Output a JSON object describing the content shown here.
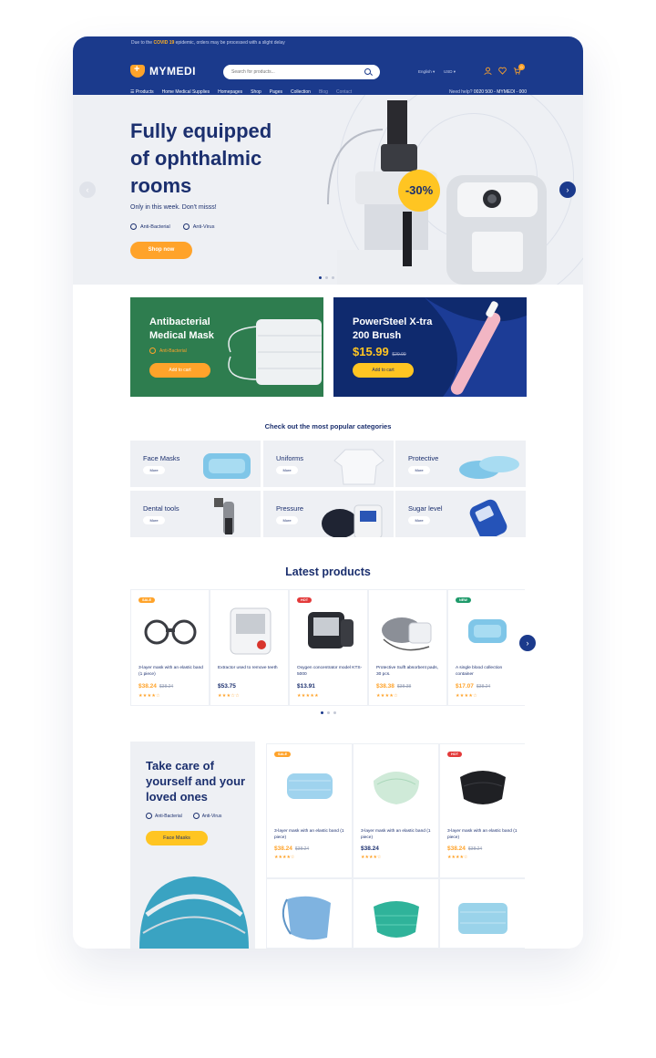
{
  "notice": {
    "prefix": "Due to the ",
    "highlight": "COVID 19",
    "suffix": " epidemic, orders may be processed with a slight delay"
  },
  "header": {
    "brand": "MYMEDI",
    "search_placeholder": "Search for products...",
    "language": "English",
    "currency": "USD",
    "cart_count": "0"
  },
  "nav": {
    "items": [
      "Products",
      "Home Medical Supplies",
      "Homepages",
      "Shop",
      "Pages",
      "Collection",
      "Blog",
      "Contact"
    ],
    "help_label": "Need help?",
    "help_phone": "0020 500 - MYMEDI - 000"
  },
  "hero": {
    "title": "Fully equipped of ophthalmic rooms",
    "subtitle": "Only in this week. Don't misss!",
    "tag1": "Anti-Bacterial",
    "tag2": "Anti-Virus",
    "cta": "Shop now",
    "discount": "-30%"
  },
  "banners": [
    {
      "title": "Antibacterial Medical Mask",
      "tag": "Anti-Bacterial",
      "button": "Add to cart"
    },
    {
      "title": "PowerSteel X-tra 200 Brush",
      "price": "$15.99",
      "old_price": "$29.99",
      "button": "Add to cart"
    }
  ],
  "categories_title": "Check out the most popular categories",
  "categories": [
    {
      "name": "Face Masks",
      "more": "More"
    },
    {
      "name": "Uniforms",
      "more": "More"
    },
    {
      "name": "Protective",
      "more": "More"
    },
    {
      "name": "Dental tools",
      "more": "More"
    },
    {
      "name": "Pressure",
      "more": "More"
    },
    {
      "name": "Sugar level",
      "more": "More"
    }
  ],
  "latest_title": "Latest products",
  "latest": [
    {
      "badge": "SALE",
      "name": "3-layer mask with an elastic band (1 piece)",
      "price": "$38.24",
      "old": "$38.24",
      "stars": "★★★★☆"
    },
    {
      "badge": "",
      "name": "Extractor used to remove teeth",
      "price": "$53.75",
      "old": "",
      "stars": "★★★☆☆"
    },
    {
      "badge": "HOT",
      "name": "Oxygen concentrator model KTS-5000",
      "price": "$13.91",
      "old": "",
      "stars": "★★★★★"
    },
    {
      "badge": "",
      "name": "Protective Sulft absorbent pads, 30 pcs.",
      "price": "$38.38",
      "old": "$38.38",
      "stars": "★★★★☆"
    },
    {
      "badge": "NEW",
      "name": "A single blood collection container",
      "price": "$17.07",
      "old": "$38.24",
      "stars": "★★★★☆"
    }
  ],
  "promo": {
    "title": "Take care of yourself and your loved ones",
    "tag1": "Anti-Bacterial",
    "tag2": "Anti-Virus",
    "button": "Face Masks"
  },
  "masks": [
    {
      "badge": "SALE",
      "name": "3-layer mask with an elastic band (1 piece)",
      "price": "$38.24",
      "old": "$38.24",
      "stars": "★★★★☆"
    },
    {
      "badge": "",
      "name": "3-layer mask with an elastic band (1 piece)",
      "price": "$38.24",
      "old": "",
      "stars": "★★★★☆"
    },
    {
      "badge": "HOT",
      "name": "3-layer mask with an elastic band (1 piece)",
      "price": "$38.24",
      "old": "$38.24",
      "stars": "★★★★☆"
    }
  ],
  "colors": {
    "navy": "#1b3a8c",
    "orange": "#ffa32a",
    "yellow": "#ffc522",
    "green": "#2e7d4f"
  }
}
